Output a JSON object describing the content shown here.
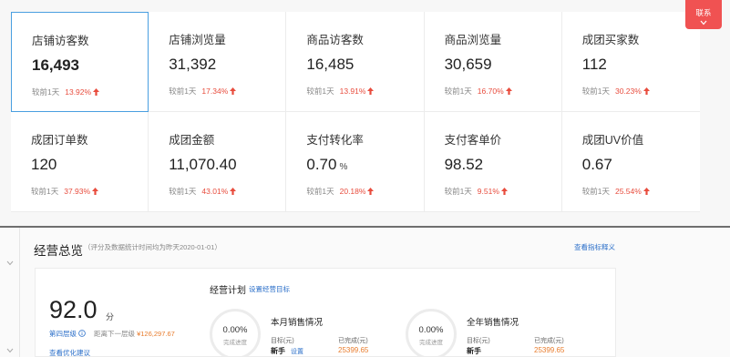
{
  "metrics": [
    {
      "label": "店铺访客数",
      "value": "16,493",
      "unit": "",
      "compare_label": "较前1天",
      "change": "13.92%",
      "active": true
    },
    {
      "label": "店铺浏览量",
      "value": "31,392",
      "unit": "",
      "compare_label": "较前1天",
      "change": "17.34%",
      "active": false
    },
    {
      "label": "商品访客数",
      "value": "16,485",
      "unit": "",
      "compare_label": "较前1天",
      "change": "13.91%",
      "active": false
    },
    {
      "label": "商品浏览量",
      "value": "30,659",
      "unit": "",
      "compare_label": "较前1天",
      "change": "16.70%",
      "active": false
    },
    {
      "label": "成团买家数",
      "value": "112",
      "unit": "",
      "compare_label": "较前1天",
      "change": "30.23%",
      "active": false
    },
    {
      "label": "成团订单数",
      "value": "120",
      "unit": "",
      "compare_label": "较前1天",
      "change": "37.93%",
      "active": false
    },
    {
      "label": "成团金额",
      "value": "11,070.40",
      "unit": "",
      "compare_label": "较前1天",
      "change": "43.01%",
      "active": false
    },
    {
      "label": "支付转化率",
      "value": "0.70",
      "unit": "%",
      "compare_label": "较前1天",
      "change": "20.18%",
      "active": false
    },
    {
      "label": "支付客单价",
      "value": "98.52",
      "unit": "",
      "compare_label": "较前1天",
      "change": "9.51%",
      "active": false
    },
    {
      "label": "成团UV价值",
      "value": "0.67",
      "unit": "",
      "compare_label": "较前1天",
      "change": "25.54%",
      "active": false
    }
  ],
  "service_tab": {
    "label": "联系"
  },
  "overview": {
    "title": "经营总览",
    "note": "（评分及数据统计时间均为昨天2020-01-01）",
    "link": "查看指标释义",
    "score": "92.0",
    "score_unit": "分",
    "level": "第四层级",
    "next_level_label": "距离下一层级",
    "next_level_amount": "¥126,297.67",
    "suggest_link": "查看优化建议",
    "plan_title": "经营计划",
    "plan_link": "设置经营目标"
  },
  "monthly": {
    "ring_pct": "0.00%",
    "ring_sub": "完成进度",
    "title": "本月销售情况",
    "target_label": "目标(元)",
    "target_value": "新手",
    "target_extra": "设置",
    "done_label": "已完成(元)",
    "done_value": "25399.65"
  },
  "yearly": {
    "ring_pct": "0.00%",
    "ring_sub": "完成进度",
    "title": "全年销售情况",
    "target_label": "目标(元)",
    "target_value": "新手",
    "done_label": "已完成(元)",
    "done_value": "25399.65"
  },
  "colors": {
    "accent_blue": "#2b6fc9",
    "up_red": "#e84c3d",
    "active_border": "#4a9fe0",
    "service_red": "#f05252"
  }
}
